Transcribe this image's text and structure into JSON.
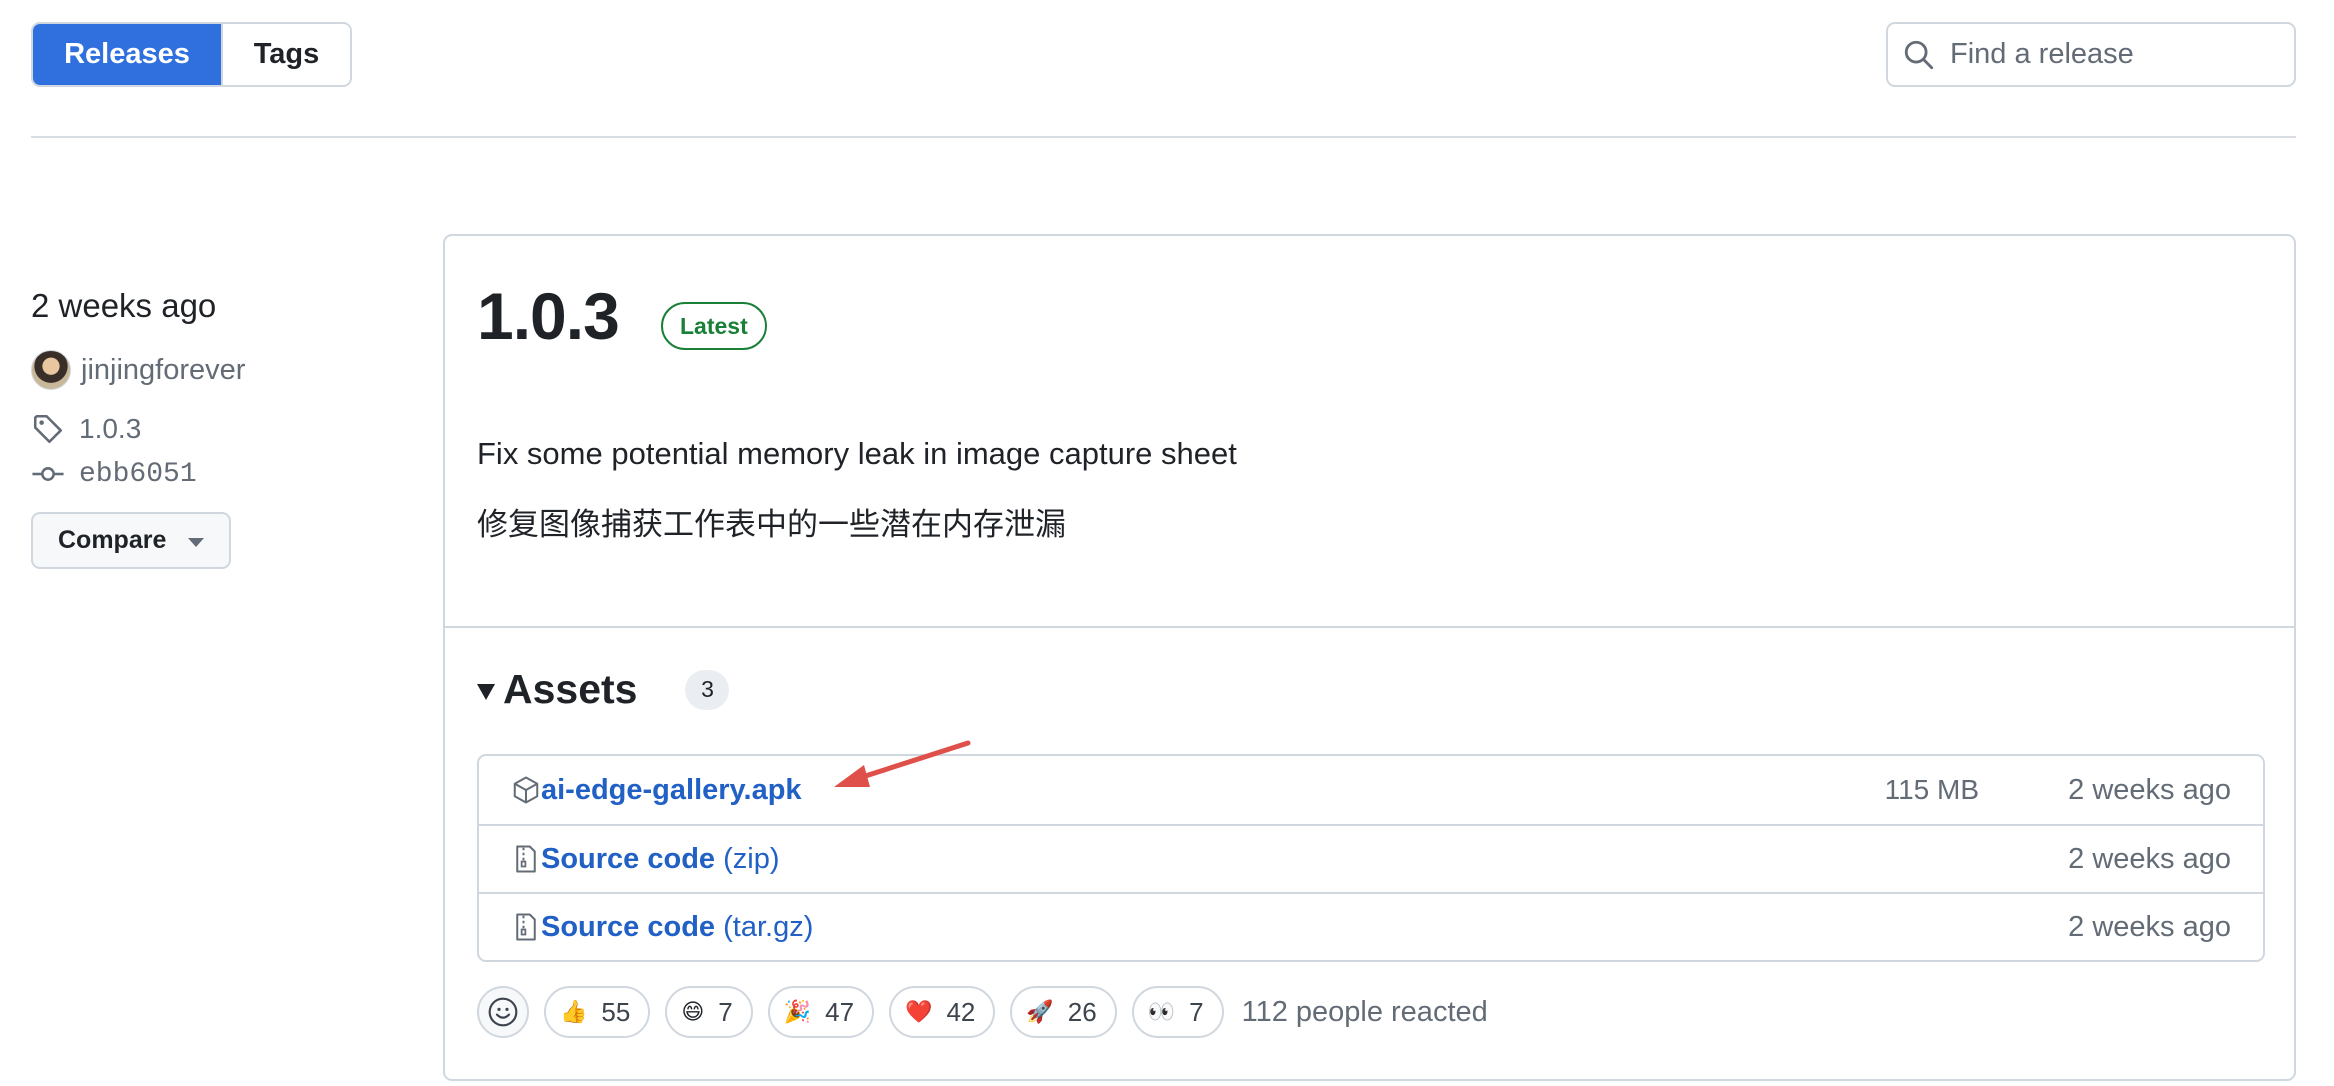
{
  "tabs": {
    "releases": "Releases",
    "tags": "Tags"
  },
  "search": {
    "placeholder": "Find a release"
  },
  "meta": {
    "time": "2 weeks ago",
    "author": "jinjingforever",
    "tag": "1.0.3",
    "commit": "ebb6051",
    "compare_label": "Compare"
  },
  "release": {
    "version": "1.0.3",
    "badge": "Latest",
    "notes": [
      "Fix some potential memory leak in image capture sheet",
      "修复图像捕获工作表中的一些潜在内存泄漏"
    ]
  },
  "assets": {
    "title": "Assets",
    "count": "3",
    "items": [
      {
        "name": "ai-edge-gallery.apk",
        "ext": "",
        "size": "115 MB",
        "time": "2 weeks ago",
        "icon": "package-icon"
      },
      {
        "name": "Source code",
        "ext": "(zip)",
        "size": "",
        "time": "2 weeks ago",
        "icon": "file-zip-icon"
      },
      {
        "name": "Source code",
        "ext": "(tar.gz)",
        "size": "",
        "time": "2 weeks ago",
        "icon": "file-zip-icon"
      }
    ]
  },
  "reactions": {
    "items": [
      {
        "emoji": "👍",
        "count": "55"
      },
      {
        "emoji": "😄",
        "count": "7"
      },
      {
        "emoji": "🎉",
        "count": "47"
      },
      {
        "emoji": "❤️",
        "count": "42"
      },
      {
        "emoji": "🚀",
        "count": "26"
      },
      {
        "emoji": "👀",
        "count": "7"
      }
    ],
    "summary": "112 people reacted"
  },
  "colors": {
    "accent": "#2f6fde",
    "link": "#2160c4",
    "success": "#1a7f37",
    "annotation_arrow": "#e0504a"
  }
}
